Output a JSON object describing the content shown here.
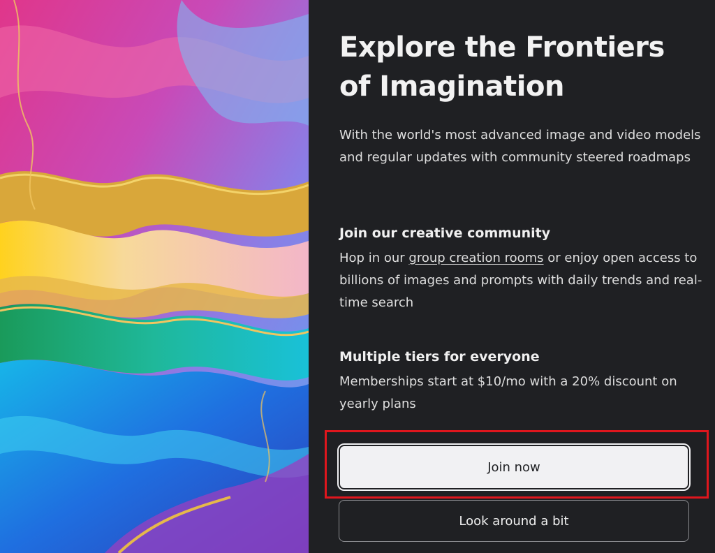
{
  "hero": {
    "headline": "Explore the Frontiers of Imagination",
    "lead": "With the world's most advanced image and video models and regular updates with community steered roadmaps"
  },
  "community": {
    "title": "Join our creative community",
    "body_before": "Hop in our",
    "link_label": "group creation rooms",
    "body_after": "or enjoy open access to billions of images and prompts with daily trends and real-time search"
  },
  "tiers": {
    "title": "Multiple tiers for everyone",
    "body": "Memberships start at $10/mo with a 20% discount on yearly plans"
  },
  "actions": {
    "join_label": "Join now",
    "browse_label": "Look around a bit"
  },
  "colors": {
    "panel_bg": "#1f2023",
    "primary_button_bg": "#f1f1f3",
    "highlight": "#e0161d"
  }
}
